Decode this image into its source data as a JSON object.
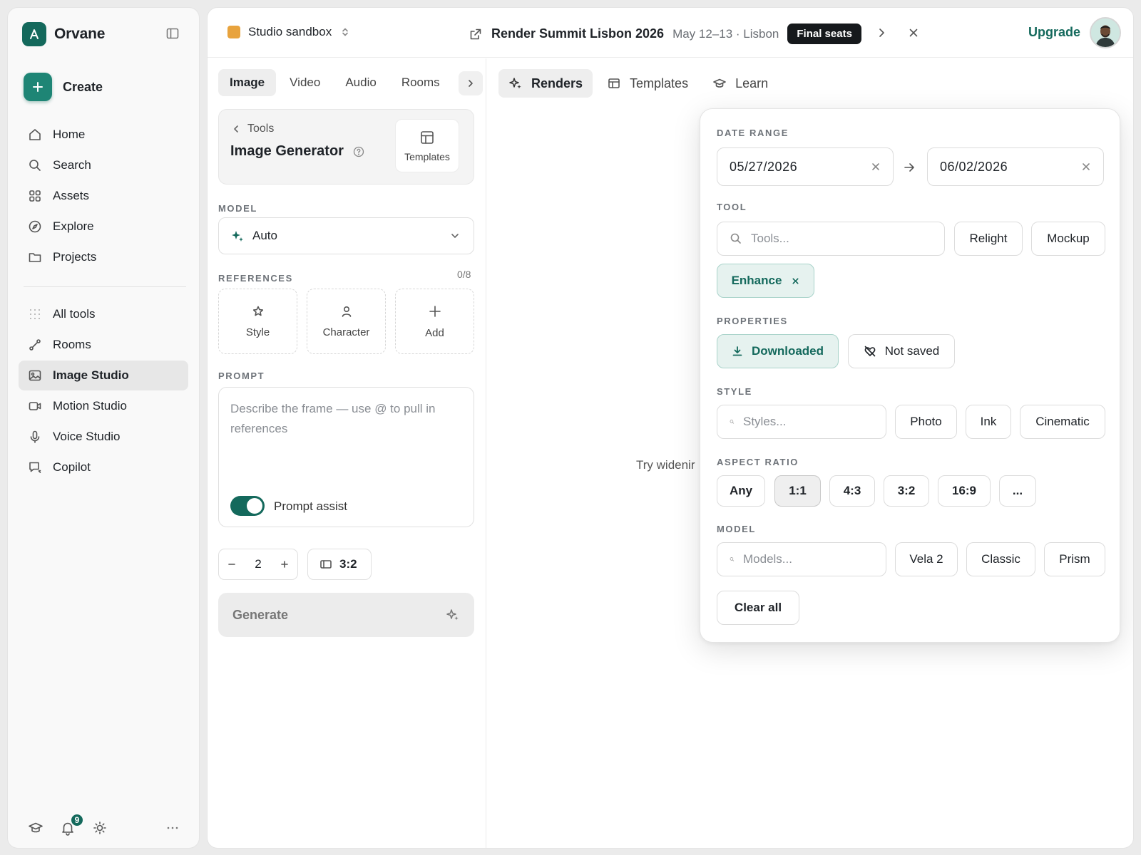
{
  "app": {
    "name": "Orvane"
  },
  "sidebar": {
    "create_label": "Create",
    "items": [
      {
        "label": "Home",
        "icon": "home-icon"
      },
      {
        "label": "Search",
        "icon": "search-icon"
      },
      {
        "label": "Assets",
        "icon": "grid-icon"
      },
      {
        "label": "Explore",
        "icon": "compass-icon"
      },
      {
        "label": "Projects",
        "icon": "folder-icon"
      },
      {
        "label": "All tools",
        "icon": "dots-grid-icon"
      },
      {
        "label": "Rooms",
        "icon": "nodes-icon"
      },
      {
        "label": "Image Studio",
        "icon": "image-icon",
        "active": true
      },
      {
        "label": "Motion Studio",
        "icon": "video-icon"
      },
      {
        "label": "Voice Studio",
        "icon": "mic-icon"
      },
      {
        "label": "Copilot",
        "icon": "chat-icon"
      }
    ],
    "notification_count": "9"
  },
  "topbar": {
    "workspace": "Studio sandbox",
    "event_title": "Render Summit Lisbon 2026",
    "event_meta": "May 12–13 · Lisbon",
    "event_badge": "Final seats",
    "upgrade_label": "Upgrade"
  },
  "left_panel": {
    "mode_tabs": [
      "Image",
      "Video",
      "Audio",
      "Rooms"
    ],
    "active_mode": "Image",
    "tool_back_label": "Tools",
    "tool_title": "Image Generator",
    "templates_label": "Templates",
    "model_section": "MODEL",
    "model_value": "Auto",
    "references_section": "REFERENCES",
    "references_count": "0/8",
    "reference_tiles": [
      "Style",
      "Character",
      "Add"
    ],
    "prompt_section": "PROMPT",
    "prompt_placeholder": "Describe the frame — use @ to pull in references",
    "prompt_assist_label": "Prompt assist",
    "prompt_assist_on": true,
    "quantity": "2",
    "aspect": "3:2",
    "generate_label": "Generate"
  },
  "view_tabs": [
    {
      "label": "Renders",
      "icon": "sparkle-icon",
      "active": true
    },
    {
      "label": "Templates",
      "icon": "layout-icon"
    },
    {
      "label": "Learn",
      "icon": "graduation-cap-icon"
    }
  ],
  "empty_hint": "Try widenir",
  "filters": {
    "date_range_label": "DATE RANGE",
    "date_from": "05/27/2026",
    "date_to": "06/02/2026",
    "tool_label": "TOOL",
    "tool_placeholder": "Tools...",
    "tool_chips": [
      "Relight",
      "Mockup"
    ],
    "tool_selected": "Enhance",
    "properties_label": "PROPERTIES",
    "properties": [
      {
        "label": "Downloaded",
        "selected": true
      },
      {
        "label": "Not saved",
        "selected": false
      }
    ],
    "style_label": "STYLE",
    "style_placeholder": "Styles...",
    "style_chips": [
      "Photo",
      "Ink",
      "Cinematic"
    ],
    "aspect_label": "ASPECT RATIO",
    "aspect_chips": [
      "Any",
      "1:1",
      "4:3",
      "3:2",
      "16:9",
      "..."
    ],
    "aspect_selected": "1:1",
    "model_label": "MODEL",
    "model_placeholder": "Models...",
    "model_chips": [
      "Vela 2",
      "Classic",
      "Prism"
    ],
    "clear_all_label": "Clear all"
  },
  "colors": {
    "accent": "#14695c",
    "accent_light": "#e6f2ef",
    "workspace_dot": "#e8a33d",
    "badge_dark": "#16191c"
  }
}
